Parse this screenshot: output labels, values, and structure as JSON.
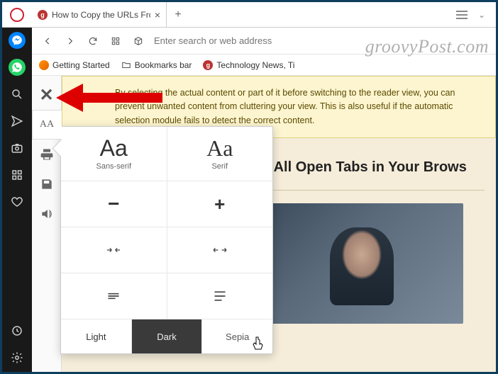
{
  "tab": {
    "title": "How to Copy the URLs Fro",
    "favicon_letter": "g"
  },
  "toolbar": {
    "omnibox_placeholder": "Enter search or web address"
  },
  "bookmarks": {
    "getting_started": "Getting Started",
    "bookmarks_bar": "Bookmarks bar",
    "tech_news": "Technology News, Ti",
    "gp_letter": "g"
  },
  "watermark": "groovyPost.com",
  "tip": "By selecting the actual content or part of it before switching to the reader view, you can prevent unwanted content from cluttering your view. This is also useful if the automatic selection module fails to detect the correct content.",
  "article": {
    "heading_fragment": "m All Open Tabs in Your Brows"
  },
  "reader_sidebar": {
    "font_label": "AA"
  },
  "popover": {
    "sans_big": "Aa",
    "sans_label": "Sans-serif",
    "serif_big": "Aa",
    "serif_label": "Serif",
    "minus": "−",
    "plus": "+",
    "theme_light": "Light",
    "theme_dark": "Dark",
    "theme_sepia": "Sepia"
  },
  "sidebar_icons": {
    "messenger": "messenger",
    "whatsapp": "whatsapp",
    "search": "search",
    "send": "send",
    "camera": "camera",
    "apps": "apps",
    "heart": "heart",
    "history": "history",
    "settings": "settings"
  }
}
